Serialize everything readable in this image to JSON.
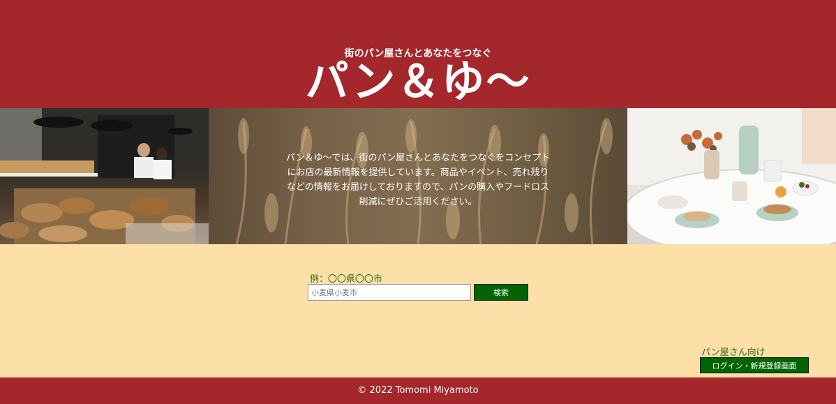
{
  "header": {
    "tagline": "街のパン屋さんとあなたをつなぐ",
    "title": "パン＆ゆ～"
  },
  "hero": {
    "description": "パン＆ゆ～では、街のパン屋さんとあなたをつなぐをコンセプトにお店の最新情報を提供しています。商品やイベント、売れ残りなどの情報をお届けしておりますので、パンの購入やフードロス削減にぜひご活用ください。",
    "images": [
      "bakery-shop-photo",
      "wheat-field-photo",
      "breakfast-table-photo"
    ]
  },
  "search": {
    "hint": "例：〇〇県〇〇市",
    "placeholder": "小麦県小麦市",
    "button_label": "検索"
  },
  "bakery_section": {
    "label": "パン屋さん向け",
    "button_label": "ログイン・新規登録画面"
  },
  "footer": {
    "copyright": "© 2022 Tomomi Miyamoto"
  },
  "colors": {
    "header_bg": "#a3272b",
    "page_bg": "#fddfa8",
    "button_bg": "#006400",
    "label_text": "#2f6b12"
  }
}
